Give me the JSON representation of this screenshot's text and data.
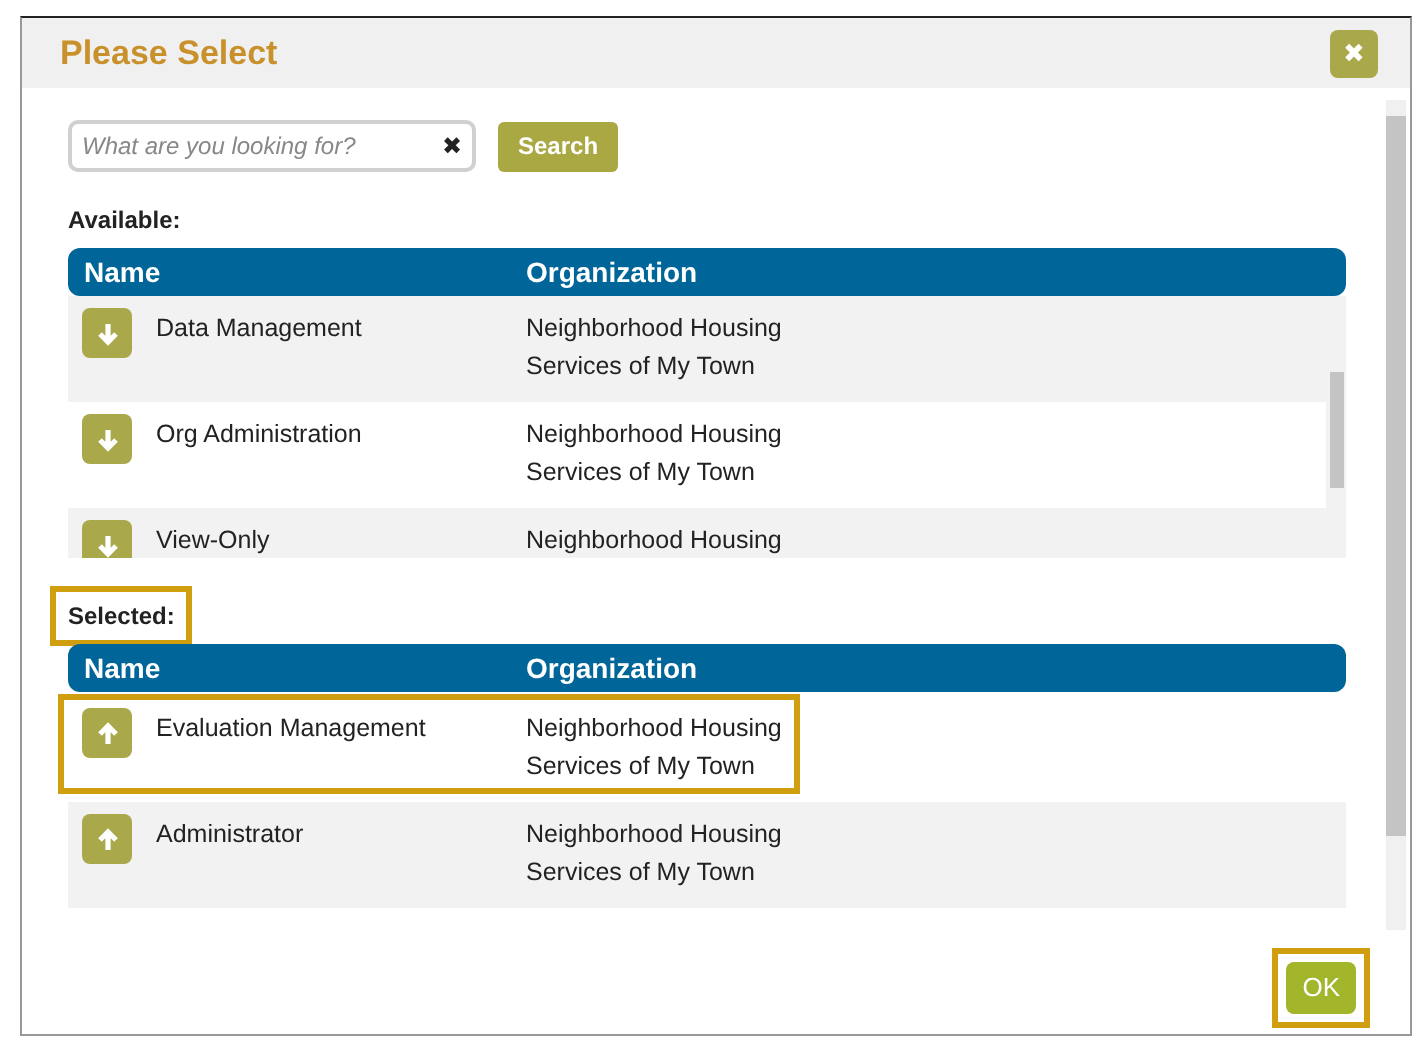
{
  "dialog": {
    "title": "Please Select",
    "close_icon": "✖"
  },
  "search": {
    "placeholder": "What are you looking for?",
    "clear_icon": "✖",
    "button": "Search"
  },
  "available": {
    "label": "Available:",
    "highlighted": false,
    "columns": [
      "Name",
      "Organization"
    ],
    "rows": [
      {
        "name": "Data Management",
        "organization": [
          "Neighborhood Housing",
          "Services of My Town"
        ],
        "highlighted": false
      },
      {
        "name": "Org Administration",
        "organization": [
          "Neighborhood Housing",
          "Services of My Town"
        ],
        "highlighted": false
      },
      {
        "name": "View-Only",
        "organization": [
          "Neighborhood Housing"
        ],
        "highlighted": false
      }
    ]
  },
  "selected": {
    "label": "Selected:",
    "highlighted": true,
    "columns": [
      "Name",
      "Organization"
    ],
    "rows": [
      {
        "name": "Evaluation Management",
        "organization": [
          "Neighborhood Housing",
          "Services of My Town"
        ],
        "highlighted": true
      },
      {
        "name": "Administrator",
        "organization": [
          "Neighborhood Housing",
          "Services of My Town"
        ],
        "highlighted": false
      }
    ]
  },
  "ok_button": {
    "label": "OK",
    "highlighted": true
  }
}
